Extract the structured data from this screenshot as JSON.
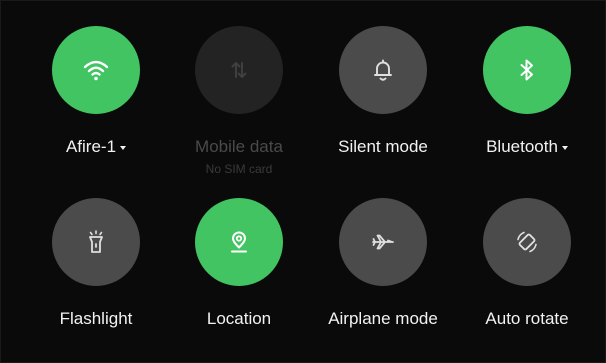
{
  "tiles": {
    "wifi": {
      "label": "Afire-1",
      "state": "on",
      "icon": "wifi-icon",
      "has_menu": true
    },
    "mobile_data": {
      "label": "Mobile data",
      "sublabel": "No SIM card",
      "state": "disabled",
      "icon": "mobile-data-icon"
    },
    "silent_mode": {
      "label": "Silent mode",
      "state": "off",
      "icon": "bell-icon"
    },
    "bluetooth": {
      "label": "Bluetooth",
      "state": "on",
      "icon": "bluetooth-icon",
      "has_menu": true
    },
    "flashlight": {
      "label": "Flashlight",
      "state": "off",
      "icon": "flashlight-icon"
    },
    "location": {
      "label": "Location",
      "state": "on",
      "icon": "location-pin-icon"
    },
    "airplane_mode": {
      "label": "Airplane mode",
      "state": "off",
      "icon": "airplane-icon"
    },
    "auto_rotate": {
      "label": "Auto rotate",
      "state": "off",
      "icon": "rotate-icon"
    }
  },
  "colors": {
    "active": "#43c463",
    "inactive": "#4b4b4b",
    "disabled": "#232323",
    "background": "#0a0a0a"
  }
}
